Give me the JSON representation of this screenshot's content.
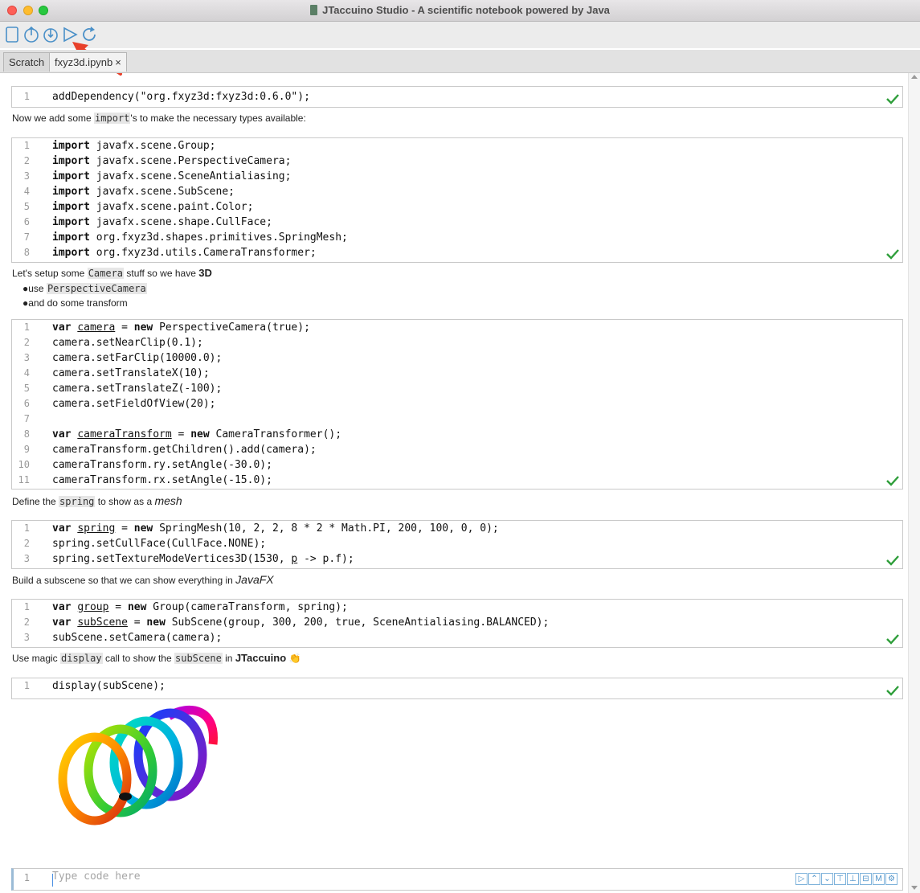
{
  "window": {
    "title": "JTaccuino Studio - A scientific notebook powered by Java"
  },
  "toolbar": {
    "icons": [
      "new-notebook-icon",
      "open-icon",
      "save-icon",
      "run-icon",
      "refresh-icon"
    ]
  },
  "tabs": [
    {
      "label": "Scratch"
    },
    {
      "label": "fxyz3d.ipynb",
      "close": "×"
    }
  ],
  "cells": [
    {
      "lines": [
        {
          "n": "1",
          "code": "addDependency(\"org.fxyz3d:fxyz3d:0.6.0\");"
        }
      ]
    },
    {
      "lines": [
        {
          "n": "1",
          "kw": "import",
          "rest": " javafx.scene.Group;"
        },
        {
          "n": "2",
          "kw": "import",
          "rest": " javafx.scene.PerspectiveCamera;"
        },
        {
          "n": "3",
          "kw": "import",
          "rest": " javafx.scene.SceneAntialiasing;"
        },
        {
          "n": "4",
          "kw": "import",
          "rest": " javafx.scene.SubScene;"
        },
        {
          "n": "5",
          "kw": "import",
          "rest": " javafx.scene.paint.Color;"
        },
        {
          "n": "6",
          "kw": "import",
          "rest": " javafx.scene.shape.CullFace;"
        },
        {
          "n": "7",
          "kw": "import",
          "rest": " org.fxyz3d.shapes.primitives.SpringMesh;"
        },
        {
          "n": "8",
          "kw": "import",
          "rest": " org.fxyz3d.utils.CameraTransformer;"
        }
      ]
    },
    {
      "lines": [
        {
          "n": "1",
          "kw": "var",
          "v": "camera",
          "mid": " = ",
          "kw2": "new",
          "rest": " PerspectiveCamera(true);"
        },
        {
          "n": "2",
          "code": "camera.setNearClip(0.1);"
        },
        {
          "n": "3",
          "code": "camera.setFarClip(10000.0);"
        },
        {
          "n": "4",
          "code": "camera.setTranslateX(10);"
        },
        {
          "n": "5",
          "code": "camera.setTranslateZ(-100);"
        },
        {
          "n": "6",
          "code": "camera.setFieldOfView(20);"
        },
        {
          "n": "7",
          "code": ""
        },
        {
          "n": "8",
          "kw": "var",
          "v": "cameraTransform",
          "mid": " = ",
          "kw2": "new",
          "rest": " CameraTransformer();"
        },
        {
          "n": "9",
          "code": "cameraTransform.getChildren().add(camera);"
        },
        {
          "n": "10",
          "code": "cameraTransform.ry.setAngle(-30.0);"
        },
        {
          "n": "11",
          "code": "cameraTransform.rx.setAngle(-15.0);"
        }
      ]
    },
    {
      "lines": [
        {
          "n": "1",
          "kw": "var",
          "v": "spring",
          "mid": " = ",
          "kw2": "new",
          "rest": " SpringMesh(10, 2, 2, 8 * 2 * Math.PI, 200, 100, 0, 0);"
        },
        {
          "n": "2",
          "code": "spring.setCullFace(CullFace.NONE);"
        },
        {
          "n": "3",
          "pre": "spring.setTextureModeVertices3D(1530, ",
          "v": "p",
          "rest": " -> p.f);"
        }
      ]
    },
    {
      "lines": [
        {
          "n": "1",
          "kw": "var",
          "v": "group",
          "mid": " = ",
          "kw2": "new",
          "rest": " Group(cameraTransform, spring);"
        },
        {
          "n": "2",
          "kw": "var",
          "v": "subScene",
          "mid": " = ",
          "kw2": "new",
          "rest": " SubScene(group, 300, 200, true, SceneAntialiasing.BALANCED);"
        },
        {
          "n": "3",
          "code": "subScene.setCamera(camera);"
        }
      ]
    },
    {
      "lines": [
        {
          "n": "1",
          "code": "display(subScene);"
        }
      ]
    }
  ],
  "markdown": {
    "imports": {
      "pre": "Now we add some ",
      "code": "import",
      "post": "'s to make the necessary types available:"
    },
    "camera": {
      "pre": "Let's setup some ",
      "code": "Camera",
      "mid": " stuff so we have ",
      "bold": "3D"
    },
    "bullet1": {
      "pre": "use ",
      "code": "PerspectiveCamera"
    },
    "bullet2": {
      "text": "and do some transform"
    },
    "spring": {
      "pre": "Define the ",
      "code": "spring",
      "mid": " to show as a ",
      "ital": "mesh"
    },
    "subscene": {
      "pre": "Build a subscene so that we can show everything in ",
      "ital": "JavaFX"
    },
    "magic": {
      "pre": "Use magic ",
      "code": "display",
      "mid": " call to show the ",
      "code2": "subScene",
      "mid2": " in ",
      "bold": "JTaccuino",
      "emoji": "👏"
    }
  },
  "new_cell": {
    "line": "1",
    "placeholder": "Type code here"
  },
  "colors": {
    "check": "#2e9e3a",
    "accent": "#4a90c8",
    "arrow": "#e8402a"
  }
}
